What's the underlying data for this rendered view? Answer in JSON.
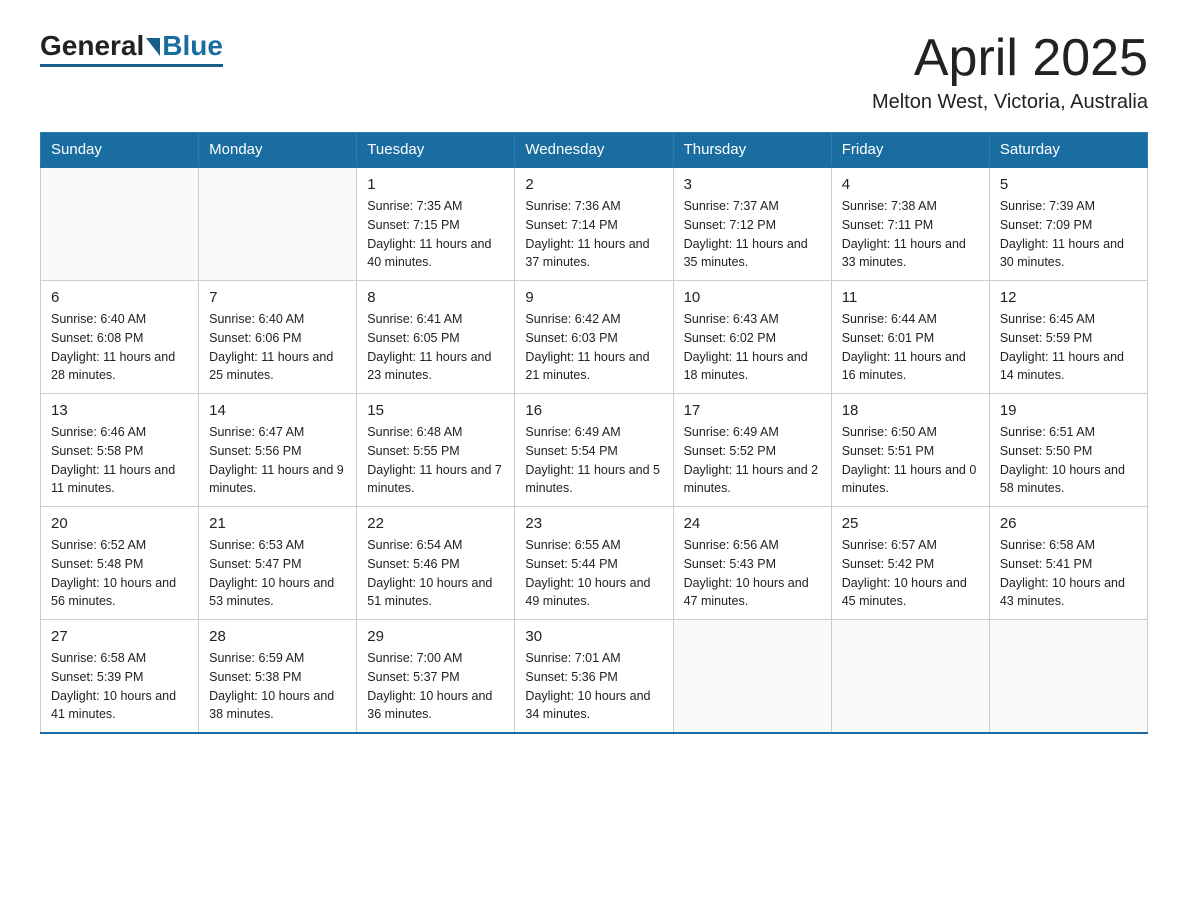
{
  "header": {
    "logo_general": "General",
    "logo_blue": "Blue",
    "month_title": "April 2025",
    "location": "Melton West, Victoria, Australia"
  },
  "days_of_week": [
    "Sunday",
    "Monday",
    "Tuesday",
    "Wednesday",
    "Thursday",
    "Friday",
    "Saturday"
  ],
  "weeks": [
    [
      {
        "day": "",
        "info": ""
      },
      {
        "day": "",
        "info": ""
      },
      {
        "day": "1",
        "info": "Sunrise: 7:35 AM\nSunset: 7:15 PM\nDaylight: 11 hours\nand 40 minutes."
      },
      {
        "day": "2",
        "info": "Sunrise: 7:36 AM\nSunset: 7:14 PM\nDaylight: 11 hours\nand 37 minutes."
      },
      {
        "day": "3",
        "info": "Sunrise: 7:37 AM\nSunset: 7:12 PM\nDaylight: 11 hours\nand 35 minutes."
      },
      {
        "day": "4",
        "info": "Sunrise: 7:38 AM\nSunset: 7:11 PM\nDaylight: 11 hours\nand 33 minutes."
      },
      {
        "day": "5",
        "info": "Sunrise: 7:39 AM\nSunset: 7:09 PM\nDaylight: 11 hours\nand 30 minutes."
      }
    ],
    [
      {
        "day": "6",
        "info": "Sunrise: 6:40 AM\nSunset: 6:08 PM\nDaylight: 11 hours\nand 28 minutes."
      },
      {
        "day": "7",
        "info": "Sunrise: 6:40 AM\nSunset: 6:06 PM\nDaylight: 11 hours\nand 25 minutes."
      },
      {
        "day": "8",
        "info": "Sunrise: 6:41 AM\nSunset: 6:05 PM\nDaylight: 11 hours\nand 23 minutes."
      },
      {
        "day": "9",
        "info": "Sunrise: 6:42 AM\nSunset: 6:03 PM\nDaylight: 11 hours\nand 21 minutes."
      },
      {
        "day": "10",
        "info": "Sunrise: 6:43 AM\nSunset: 6:02 PM\nDaylight: 11 hours\nand 18 minutes."
      },
      {
        "day": "11",
        "info": "Sunrise: 6:44 AM\nSunset: 6:01 PM\nDaylight: 11 hours\nand 16 minutes."
      },
      {
        "day": "12",
        "info": "Sunrise: 6:45 AM\nSunset: 5:59 PM\nDaylight: 11 hours\nand 14 minutes."
      }
    ],
    [
      {
        "day": "13",
        "info": "Sunrise: 6:46 AM\nSunset: 5:58 PM\nDaylight: 11 hours\nand 11 minutes."
      },
      {
        "day": "14",
        "info": "Sunrise: 6:47 AM\nSunset: 5:56 PM\nDaylight: 11 hours\nand 9 minutes."
      },
      {
        "day": "15",
        "info": "Sunrise: 6:48 AM\nSunset: 5:55 PM\nDaylight: 11 hours\nand 7 minutes."
      },
      {
        "day": "16",
        "info": "Sunrise: 6:49 AM\nSunset: 5:54 PM\nDaylight: 11 hours\nand 5 minutes."
      },
      {
        "day": "17",
        "info": "Sunrise: 6:49 AM\nSunset: 5:52 PM\nDaylight: 11 hours\nand 2 minutes."
      },
      {
        "day": "18",
        "info": "Sunrise: 6:50 AM\nSunset: 5:51 PM\nDaylight: 11 hours\nand 0 minutes."
      },
      {
        "day": "19",
        "info": "Sunrise: 6:51 AM\nSunset: 5:50 PM\nDaylight: 10 hours\nand 58 minutes."
      }
    ],
    [
      {
        "day": "20",
        "info": "Sunrise: 6:52 AM\nSunset: 5:48 PM\nDaylight: 10 hours\nand 56 minutes."
      },
      {
        "day": "21",
        "info": "Sunrise: 6:53 AM\nSunset: 5:47 PM\nDaylight: 10 hours\nand 53 minutes."
      },
      {
        "day": "22",
        "info": "Sunrise: 6:54 AM\nSunset: 5:46 PM\nDaylight: 10 hours\nand 51 minutes."
      },
      {
        "day": "23",
        "info": "Sunrise: 6:55 AM\nSunset: 5:44 PM\nDaylight: 10 hours\nand 49 minutes."
      },
      {
        "day": "24",
        "info": "Sunrise: 6:56 AM\nSunset: 5:43 PM\nDaylight: 10 hours\nand 47 minutes."
      },
      {
        "day": "25",
        "info": "Sunrise: 6:57 AM\nSunset: 5:42 PM\nDaylight: 10 hours\nand 45 minutes."
      },
      {
        "day": "26",
        "info": "Sunrise: 6:58 AM\nSunset: 5:41 PM\nDaylight: 10 hours\nand 43 minutes."
      }
    ],
    [
      {
        "day": "27",
        "info": "Sunrise: 6:58 AM\nSunset: 5:39 PM\nDaylight: 10 hours\nand 41 minutes."
      },
      {
        "day": "28",
        "info": "Sunrise: 6:59 AM\nSunset: 5:38 PM\nDaylight: 10 hours\nand 38 minutes."
      },
      {
        "day": "29",
        "info": "Sunrise: 7:00 AM\nSunset: 5:37 PM\nDaylight: 10 hours\nand 36 minutes."
      },
      {
        "day": "30",
        "info": "Sunrise: 7:01 AM\nSunset: 5:36 PM\nDaylight: 10 hours\nand 34 minutes."
      },
      {
        "day": "",
        "info": ""
      },
      {
        "day": "",
        "info": ""
      },
      {
        "day": "",
        "info": ""
      }
    ]
  ]
}
